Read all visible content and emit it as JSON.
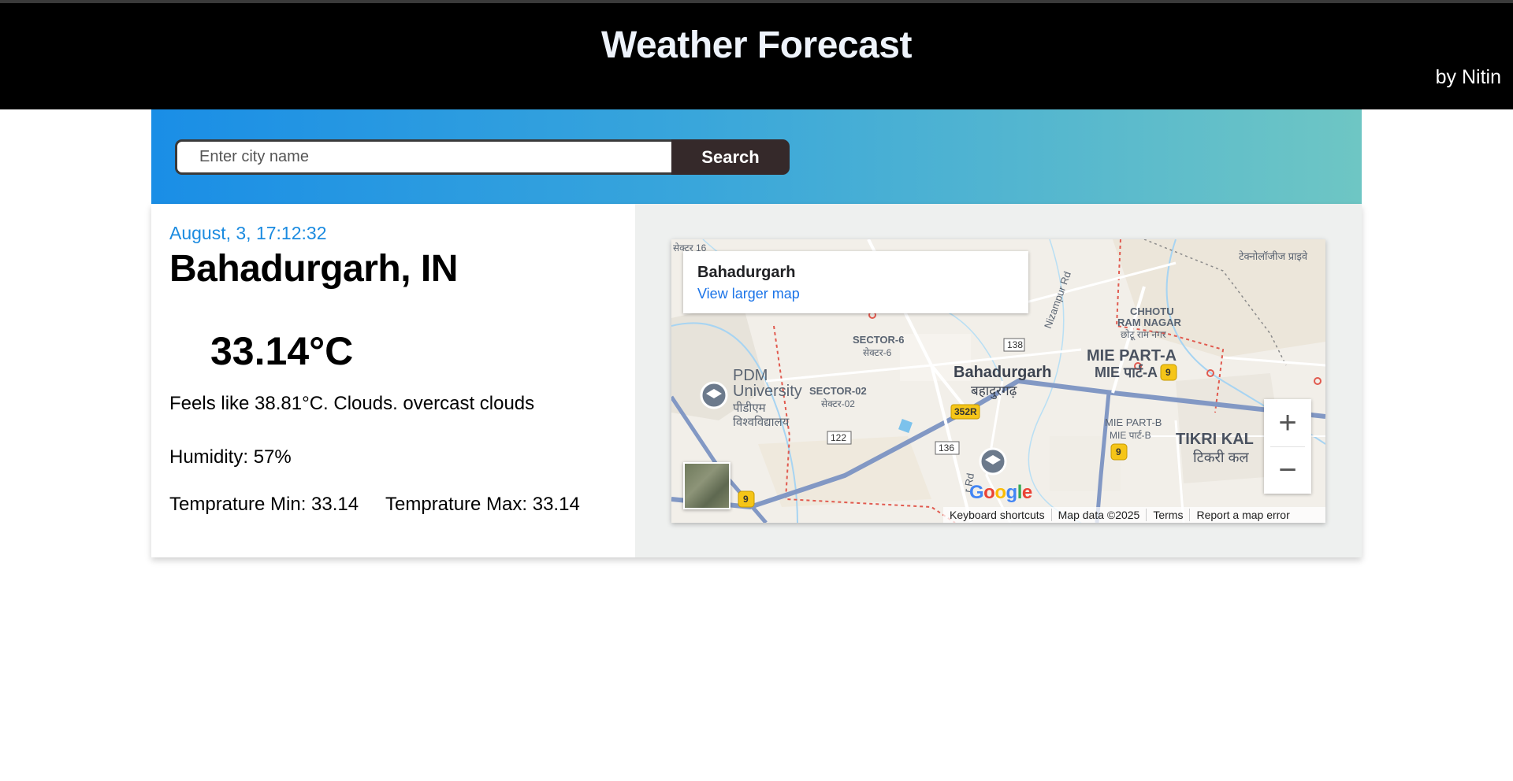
{
  "header": {
    "title": "Weather Forecast",
    "byline": "by Nitin"
  },
  "search": {
    "placeholder": "Enter city name",
    "value": "",
    "button_label": "Search"
  },
  "weather": {
    "datetime": "August, 3, 17:12:32",
    "location": "Bahadurgarh, IN",
    "temperature": "33.14°C",
    "description": "Feels like 38.81°C. Clouds. overcast clouds",
    "humidity": "Humidity: 57%",
    "temp_min": "Temprature Min: 33.14",
    "temp_max": "Temprature Max: 33.14"
  },
  "map": {
    "info_title": "Bahadurgarh",
    "info_link": "View larger map",
    "zoom_in": "+",
    "zoom_out": "−",
    "labels": {
      "sector16": "सेक्टर 16",
      "sector6": "SECTOR-6",
      "sector6_hi": "सेक्टर-6",
      "pdm1": "PDM",
      "pdm2": "University",
      "pdm3": "पीडीएम",
      "pdm4": "विश्वविद्यालय",
      "sector02": "SECTOR-02",
      "sector02_hi": "सेक्टर-02",
      "city": "Bahadurgarh",
      "city_hi": "बहादुरगढ़",
      "nizampur": "Nizampur Rd",
      "chhotu1": "CHHOTU",
      "chhotu2": "RAM NAGAR",
      "chhotu3": "छोटू राम नगर",
      "miea": "MIE PART-A",
      "miea_hi": "MIE पार्ट-A",
      "mieb": "MIE PART-B",
      "mieb_hi": "MIE पार्ट-B",
      "tikri": "TIKRI KAL",
      "tikri_hi": "टिकरी कल",
      "tech": "टेक्नोलॉजीज प्राइवे",
      "rd": "r Rd",
      "r138": "138",
      "r122": "122",
      "r136": "136",
      "r352r": "352R",
      "r9": "9"
    },
    "footer": {
      "keyboard": "Keyboard shortcuts",
      "mapdata": "Map data ©2025",
      "terms": "Terms",
      "report": "Report a map error"
    },
    "google_letters": [
      "G",
      "o",
      "o",
      "g",
      "l",
      "e"
    ],
    "google_colors": [
      "#4285F4",
      "#EA4335",
      "#FBBC05",
      "#4285F4",
      "#34A853",
      "#EA4335"
    ]
  },
  "colors": {
    "header_bg": "#000000",
    "accent_date": "#1b8be0",
    "search_button": "#35292a",
    "link": "#1a73e8"
  },
  "icons": {
    "university_marker": "graduation-cap-icon",
    "satellite_toggle": "satellite-thumbnail-icon"
  }
}
